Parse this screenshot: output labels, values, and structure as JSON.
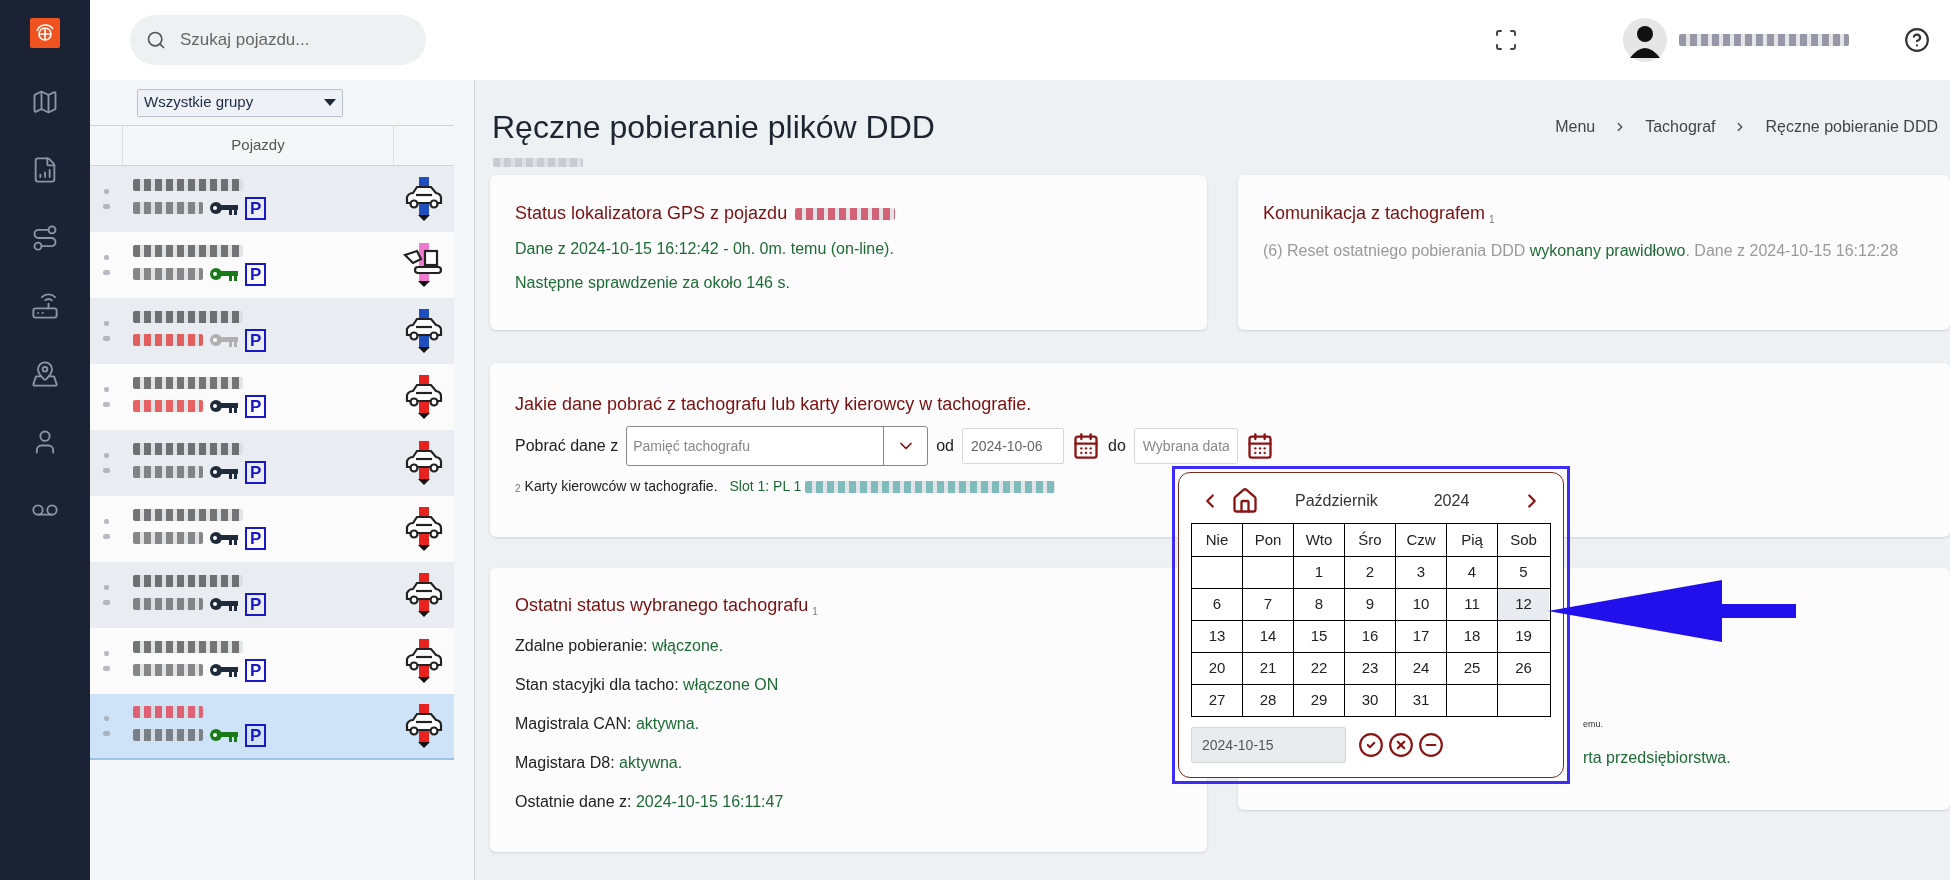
{
  "search": {
    "placeholder": "Szukaj pojazdu..."
  },
  "vehicles": {
    "group_select": "Wszystkie grupy",
    "column_header": "Pojazdy",
    "rows": [
      {
        "badge": "P",
        "key": {
          "color": "#1f2a3a"
        },
        "color": "#1f4fbf",
        "kind": "car",
        "selected": false
      },
      {
        "badge": "P",
        "key": {
          "color": "#1a7a1a"
        },
        "color": "#f07ad0",
        "kind": "excavator",
        "selected": false
      },
      {
        "badge": "P",
        "key": {
          "color": "#b0b0b0"
        },
        "color": "#1f4fbf",
        "kind": "car",
        "selected": false
      },
      {
        "badge": "P",
        "key": {
          "color": "#1f2a3a"
        },
        "color": "#e8231f",
        "kind": "car",
        "selected": false
      },
      {
        "badge": "P",
        "key": {
          "color": "#1f2a3a"
        },
        "color": "#e8231f",
        "kind": "car",
        "selected": false
      },
      {
        "badge": "P",
        "key": {
          "color": "#1f2a3a"
        },
        "color": "#e8231f",
        "kind": "car",
        "selected": false
      },
      {
        "badge": "P",
        "key": {
          "color": "#1f2a3a"
        },
        "color": "#e8231f",
        "kind": "car",
        "selected": false
      },
      {
        "badge": "P",
        "key": {
          "color": "#1f2a3a"
        },
        "color": "#e8231f",
        "kind": "car",
        "selected": false
      },
      {
        "badge": "P",
        "key": {
          "color": "#1a7a1a"
        },
        "color": "#e8231f",
        "kind": "car",
        "selected": true
      }
    ]
  },
  "page": {
    "title": "Ręczne pobieranie plików DDD",
    "breadcrumb": [
      "Menu",
      "Tachograf",
      "Ręczne pobieranie DDD"
    ]
  },
  "gps_card": {
    "title": "Status lokalizatora GPS z pojazdu",
    "lines": [
      "Dane z 2024-10-15 16:12:42 - 0h. 0m. temu (on-line).",
      "Następne sprawdzenie za około 146 s."
    ]
  },
  "comm_card": {
    "title": "Komunikacja z tachografem",
    "note": "1",
    "body": [
      {
        "kind": "plain",
        "text": "(6) Reset ostatniego pobierania DDD "
      },
      {
        "kind": "ok",
        "text": "wykonany prawidłowo"
      },
      {
        "kind": "plain",
        "text": ". Dane z 2024-10-15 16:12:28"
      }
    ]
  },
  "download_card": {
    "title": "Jakie dane pobrać z tachografu lub karty kierowcy w tachografie.",
    "source_label": "Pobrać dane z",
    "source_placeholder": "Pamięć tachografu",
    "from_label": "od",
    "from_value": "2024-10-06",
    "to_label": "do",
    "to_placeholder": "Wybrana data",
    "cards_note": "2",
    "cards_label": "Karty kierowców w tachografie.",
    "slot_text": "Slot 1: PL 1"
  },
  "status_card": {
    "title": "Ostatni status wybranego tachografu",
    "note": "1",
    "items": [
      {
        "label": "Zdalne pobieranie:",
        "value": "włączone."
      },
      {
        "label": "Stan stacyjki dla tacho:",
        "value": "włączone ON"
      },
      {
        "label": "Magistrala CAN:",
        "value": "aktywna."
      },
      {
        "label": "Magistara D8:",
        "value": "aktywna."
      },
      {
        "label": "Ostatnie dane z:",
        "value": "2024-10-15 16:11:47"
      }
    ]
  },
  "right_card": {
    "small_text": "emu.",
    "status_text": "rta przedsiębiorstwa."
  },
  "calendar": {
    "month": "Październik",
    "year": "2024",
    "weekdays": [
      "Nie",
      "Pon",
      "Wto",
      "Śro",
      "Czw",
      "Pią",
      "Sob"
    ],
    "weeks": [
      [
        {
          "day": "1",
          "hovered": false
        },
        {
          "day": "2",
          "hovered": false
        },
        {
          "day": "3",
          "hovered": false
        },
        {
          "day": "4",
          "hovered": false
        },
        {
          "day": "5",
          "hovered": false
        }
      ],
      [
        {
          "day": "6",
          "hovered": false
        },
        {
          "day": "7",
          "hovered": false
        },
        {
          "day": "8",
          "hovered": false
        },
        {
          "day": "9",
          "hovered": false
        },
        {
          "day": "10",
          "hovered": false
        },
        {
          "day": "11",
          "hovered": false
        },
        {
          "day": "12",
          "hovered": true
        }
      ],
      [
        {
          "day": "13",
          "hovered": false
        },
        {
          "day": "14",
          "hovered": false
        },
        {
          "day": "15",
          "hovered": false
        },
        {
          "day": "16",
          "hovered": false
        },
        {
          "day": "17",
          "hovered": false
        },
        {
          "day": "18",
          "hovered": false
        },
        {
          "day": "19",
          "hovered": false
        }
      ],
      [
        {
          "day": "20",
          "hovered": false
        },
        {
          "day": "21",
          "hovered": false
        },
        {
          "day": "22",
          "hovered": false
        },
        {
          "day": "23",
          "hovered": false
        },
        {
          "day": "24",
          "hovered": false
        },
        {
          "day": "25",
          "hovered": false
        },
        {
          "day": "26",
          "hovered": false
        }
      ],
      [
        {
          "day": "27",
          "hovered": false
        },
        {
          "day": "28",
          "hovered": false
        },
        {
          "day": "29",
          "hovered": false
        },
        {
          "day": "30",
          "hovered": false
        },
        {
          "day": "31",
          "hovered": false
        }
      ]
    ],
    "value": "2024-10-15"
  }
}
